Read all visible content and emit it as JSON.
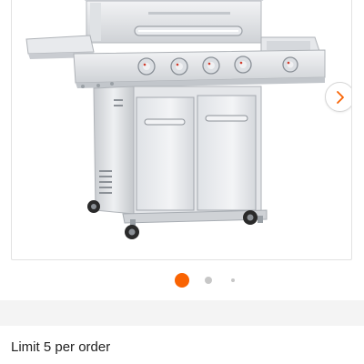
{
  "gallery": {
    "product_image_alt": "Stainless steel 4-burner gas grill with side burner",
    "next_icon": "chevron-right-icon",
    "dots": {
      "count": 3,
      "active_index": 0
    },
    "accent_color": "#f96302"
  },
  "purchase": {
    "limit_text": "Limit 5 per order"
  }
}
